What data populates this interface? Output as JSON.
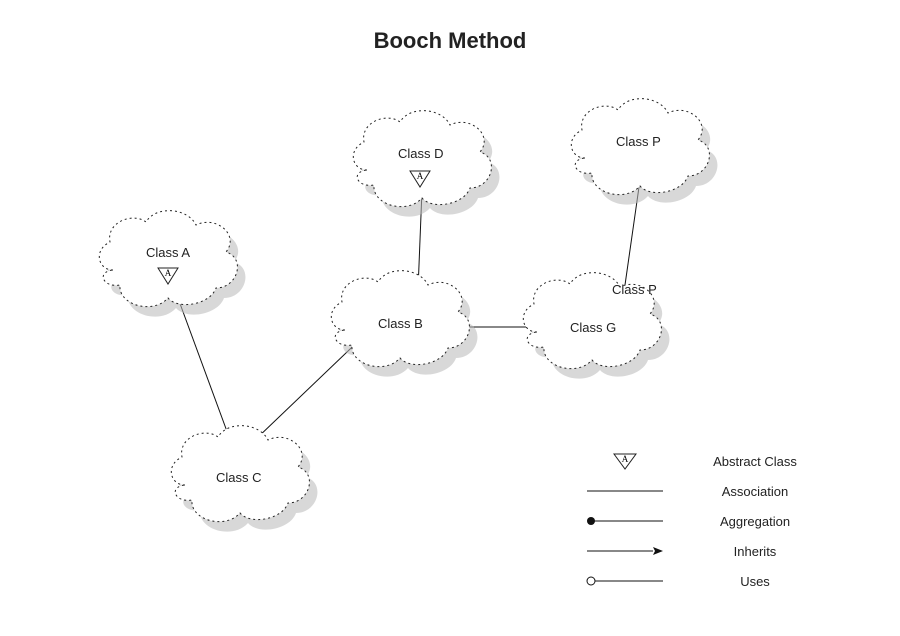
{
  "title": "Booch Method",
  "nodes": {
    "A": {
      "label": "Class A",
      "abstract": true
    },
    "B": {
      "label": "Class B",
      "abstract": false
    },
    "C": {
      "label": "Class C",
      "abstract": false
    },
    "D": {
      "label": "Class D",
      "abstract": true
    },
    "G": {
      "label": "Class G",
      "abstract": false
    },
    "P_top": {
      "label": "Class P",
      "abstract": false
    },
    "P_mid": {
      "label": "Class P",
      "abstract": false
    }
  },
  "edges": [
    {
      "from": "C",
      "to": "A",
      "type": "inherits"
    },
    {
      "from": "C",
      "to": "B",
      "type": "inherits"
    },
    {
      "from": "B",
      "to": "D",
      "type": "inherits"
    },
    {
      "from": "B",
      "to": "G",
      "type": "aggregation"
    },
    {
      "from": "G",
      "to": "P_mid",
      "type": "uses"
    },
    {
      "from": "P_mid",
      "to": "P_top",
      "type": "association"
    }
  ],
  "legend": {
    "abstract": "Abstract Class",
    "association": "Association",
    "aggregation": "Aggregation",
    "inherits": "Inherits",
    "uses": "Uses"
  },
  "abstract_badge_letter": "A"
}
